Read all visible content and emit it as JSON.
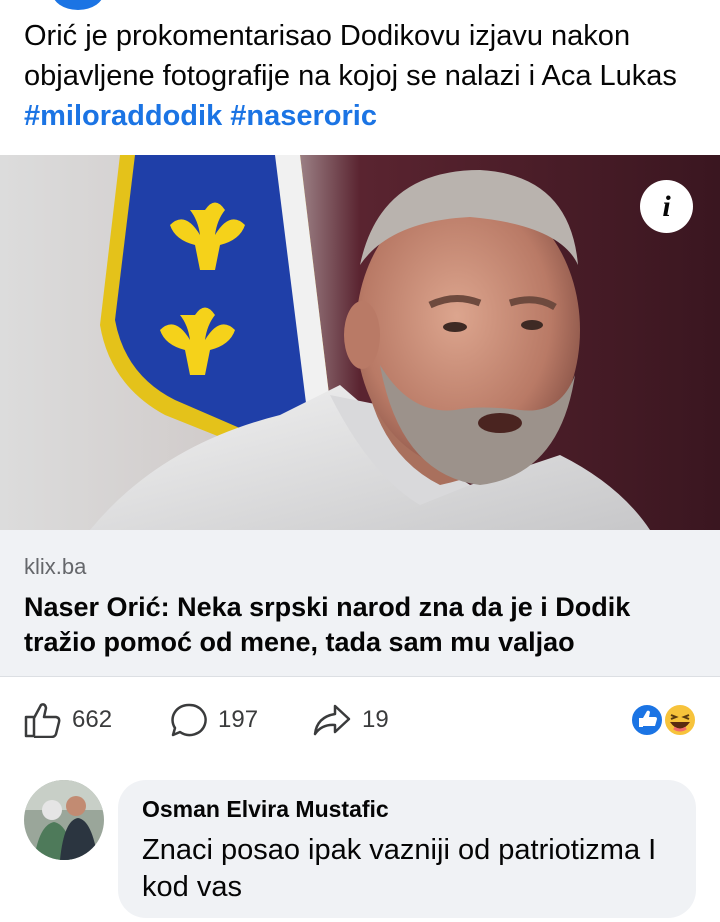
{
  "post": {
    "caption_text": "Orić je prokomentarisao Dodikovu izjavu nakon objavljene fotografije na kojoj se nalazi i Aca Lukas ",
    "hashtags": [
      "#miloraddodik",
      "#naseroric"
    ]
  },
  "link_preview": {
    "info_icon_glyph": "i",
    "domain": "klix.ba",
    "headline": "Naser Orić: Neka srpski narod zna da je i Dodik tražio pomoć od mene, tada sam mu valjao"
  },
  "actions": {
    "like_count": "662",
    "comment_count": "197",
    "share_count": "19",
    "icons": [
      "thumbs-up-icon",
      "comment-bubble-icon",
      "share-arrow-icon"
    ],
    "reactions": [
      "like-reaction-icon",
      "haha-reaction-icon"
    ]
  },
  "comment": {
    "author": "Osman Elvira Mustafic",
    "text": "Znaci posao ipak vazniji od patriotizma I kod vas"
  },
  "colors": {
    "link_blue": "#1b74e4",
    "card_bg": "#f0f2f5",
    "secondary_text": "#65676b"
  }
}
